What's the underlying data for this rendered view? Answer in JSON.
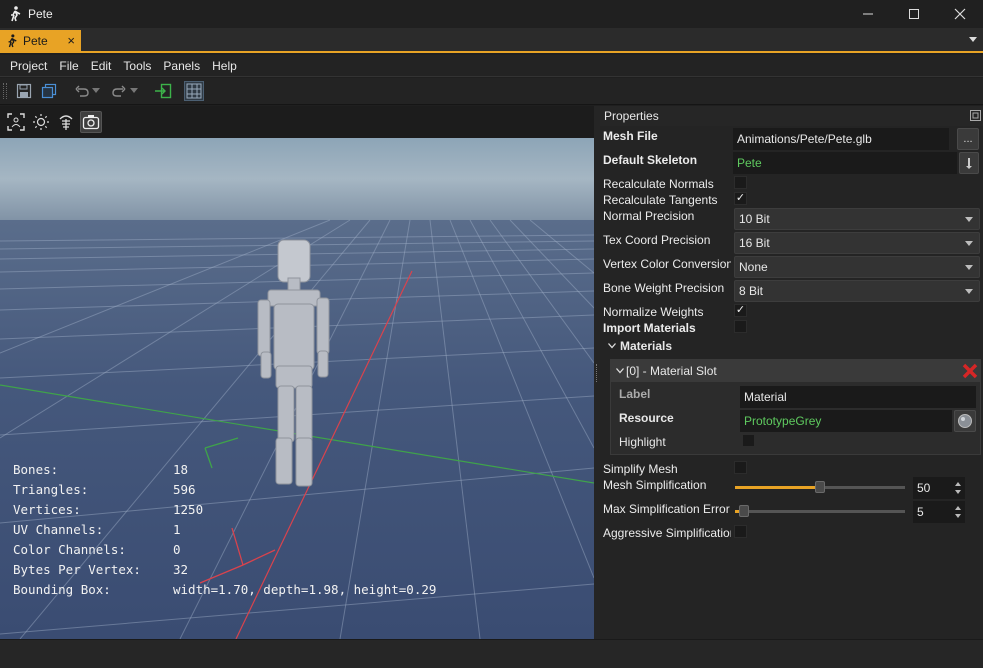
{
  "window": {
    "title": "Pete",
    "minimize_icon": "minimize-icon",
    "maximize_icon": "maximize-icon",
    "close_icon": "close-icon"
  },
  "doc_tab": {
    "label": "Pete",
    "close_glyph": "×"
  },
  "menu": [
    {
      "label": "Project"
    },
    {
      "label": "File"
    },
    {
      "label": "Edit"
    },
    {
      "label": "Tools"
    },
    {
      "label": "Panels"
    },
    {
      "label": "Help"
    }
  ],
  "toolbar": {
    "icons": [
      "save-icon",
      "save-all-icon",
      "undo-icon",
      "redo-icon",
      "export-icon",
      "grid-icon"
    ]
  },
  "viewport": {
    "tool_icons": [
      "focus-icon",
      "light-icon",
      "skeleton-icon",
      "camera-icon"
    ],
    "stats": [
      {
        "label": "Bones:",
        "value": "18"
      },
      {
        "label": "Triangles:",
        "value": "596"
      },
      {
        "label": "Vertices:",
        "value": "1250"
      },
      {
        "label": "UV Channels:",
        "value": "1"
      },
      {
        "label": "Color Channels:",
        "value": "0"
      },
      {
        "label": "Bytes Per Vertex:",
        "value": "32"
      },
      {
        "label": "Bounding Box:",
        "value": "width=1.70, depth=1.98, height=0.29"
      }
    ],
    "sky_color": "#8aa3b8",
    "ground_color": "#3b4f74"
  },
  "properties": {
    "title": "Properties",
    "mesh_file_label": "Mesh File",
    "mesh_file_value": "Animations/Pete/Pete.glb",
    "browse_label": "...",
    "default_skeleton_label": "Default Skeleton",
    "default_skeleton_value": "Pete",
    "recalc_normals_label": "Recalculate Normals",
    "recalc_normals_checked": false,
    "recalc_tangents_label": "Recalculate Tangents",
    "recalc_tangents_checked": true,
    "normal_precision_label": "Normal Precision",
    "normal_precision_value": "10 Bit",
    "tex_coord_label": "Tex Coord Precision",
    "tex_coord_value": "16 Bit",
    "vertex_color_label": "Vertex Color Conversion",
    "vertex_color_value": "None",
    "bone_weight_label": "Bone Weight Precision",
    "bone_weight_value": "8 Bit",
    "normalize_weights_label": "Normalize Weights",
    "normalize_weights_checked": true,
    "import_materials_label": "Import Materials",
    "import_materials_checked": false,
    "materials_label": "Materials",
    "slot": {
      "header": "[0] - Material Slot",
      "label_label": "Label",
      "label_value": "Material",
      "resource_label": "Resource",
      "resource_value": "PrototypeGrey",
      "highlight_label": "Highlight",
      "highlight_checked": false
    },
    "simplify_mesh_label": "Simplify Mesh",
    "simplify_mesh_checked": false,
    "mesh_simplification_label": "Mesh Simplification",
    "mesh_simplification_value": "50",
    "mesh_simplification_fraction": 0.5,
    "max_error_label": "Max Simplification Error",
    "max_error_value": "5",
    "max_error_fraction": 0.05,
    "aggressive_label": "Aggressive Simplification",
    "aggressive_checked": false,
    "accent_color": "#e8a325",
    "green_text_color": "#5fca5f",
    "delete_icon": "delete-x-icon"
  }
}
